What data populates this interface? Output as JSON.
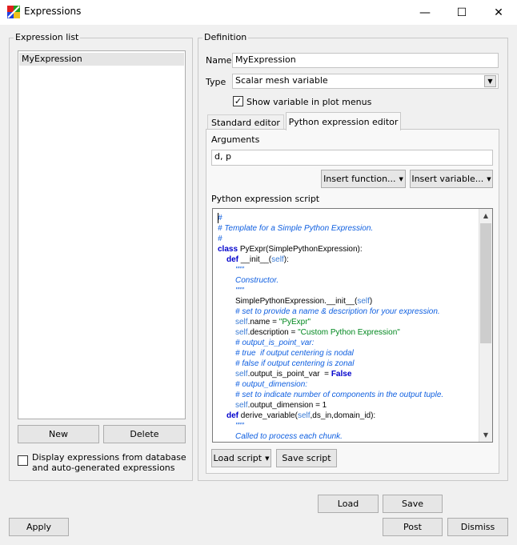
{
  "window": {
    "title": "Expressions",
    "minimize": "—",
    "maximize": "☐",
    "close": "✕"
  },
  "expression_list": {
    "legend": "Expression list",
    "items": [
      "MyExpression"
    ],
    "new_label": "New",
    "delete_label": "Delete",
    "display_checkbox_label_line1": "Display expressions from database",
    "display_checkbox_label_line2": "and auto-generated expressions",
    "display_checked": false
  },
  "definition": {
    "legend": "Definition",
    "name_label": "Name",
    "name_value": "MyExpression",
    "type_label": "Type",
    "type_value": "Scalar mesh variable",
    "show_variable_label": "Show variable in plot menus",
    "show_variable_checked": true,
    "tabs": [
      "Standard editor",
      "Python expression editor"
    ],
    "active_tab": "Python expression editor",
    "arguments_label": "Arguments",
    "arguments_value": "d, p",
    "insert_function_label": "Insert function...",
    "insert_variable_label": "Insert variable...",
    "script_label": "Python expression script",
    "load_script_label": "Load script",
    "save_script_label": "Save script"
  },
  "script_lines": [
    {
      "indent": 0,
      "segments": [
        {
          "t": "#",
          "s": "comment"
        }
      ]
    },
    {
      "indent": 0,
      "segments": [
        {
          "t": "# Template for a Simple Python Expression.",
          "s": "comment"
        }
      ]
    },
    {
      "indent": 0,
      "segments": [
        {
          "t": "#",
          "s": "comment"
        }
      ]
    },
    {
      "indent": 0,
      "segments": [
        {
          "t": "class ",
          "s": "keyword"
        },
        {
          "t": "PyExpr(SimplePythonExpression):",
          "s": "plain"
        }
      ]
    },
    {
      "indent": 1,
      "segments": [
        {
          "t": "def ",
          "s": "keyword"
        },
        {
          "t": "__init__(",
          "s": "plain"
        },
        {
          "t": "self",
          "s": "self"
        },
        {
          "t": "):",
          "s": "plain"
        }
      ]
    },
    {
      "indent": 2,
      "segments": [
        {
          "t": "\"\"\"",
          "s": "comment"
        }
      ]
    },
    {
      "indent": 2,
      "segments": [
        {
          "t": "Constructor.",
          "s": "comment"
        }
      ]
    },
    {
      "indent": 2,
      "segments": [
        {
          "t": "\"\"\"",
          "s": "comment"
        }
      ]
    },
    {
      "indent": 2,
      "segments": [
        {
          "t": "SimplePythonExpression.__init__(",
          "s": "plain"
        },
        {
          "t": "self",
          "s": "self"
        },
        {
          "t": ")",
          "s": "plain"
        }
      ]
    },
    {
      "indent": 2,
      "segments": [
        {
          "t": "# set to provide a name & description for your expression.",
          "s": "comment"
        }
      ]
    },
    {
      "indent": 2,
      "segments": [
        {
          "t": "self",
          "s": "self"
        },
        {
          "t": ".name = ",
          "s": "plain"
        },
        {
          "t": "\"PyExpr\"",
          "s": "string"
        }
      ]
    },
    {
      "indent": 2,
      "segments": [
        {
          "t": "self",
          "s": "self"
        },
        {
          "t": ".description = ",
          "s": "plain"
        },
        {
          "t": "\"Custom Python Expression\"",
          "s": "string"
        }
      ]
    },
    {
      "indent": 2,
      "segments": [
        {
          "t": "# output_is_point_var:",
          "s": "comment"
        }
      ]
    },
    {
      "indent": 2,
      "segments": [
        {
          "t": "# true  if output centering is nodal",
          "s": "comment"
        }
      ]
    },
    {
      "indent": 2,
      "segments": [
        {
          "t": "# false if output centering is zonal",
          "s": "comment"
        }
      ]
    },
    {
      "indent": 2,
      "segments": [
        {
          "t": "self",
          "s": "self"
        },
        {
          "t": ".output_is_point_var  = ",
          "s": "plain"
        },
        {
          "t": "False",
          "s": "keyword"
        }
      ]
    },
    {
      "indent": 2,
      "segments": [
        {
          "t": "# output_dimension:",
          "s": "comment"
        }
      ]
    },
    {
      "indent": 2,
      "segments": [
        {
          "t": "# set to indicate number of components in the output tuple.",
          "s": "comment"
        }
      ]
    },
    {
      "indent": 2,
      "segments": [
        {
          "t": "self",
          "s": "self"
        },
        {
          "t": ".output_dimension = 1",
          "s": "plain"
        }
      ]
    },
    {
      "indent": 1,
      "segments": [
        {
          "t": "def ",
          "s": "keyword"
        },
        {
          "t": "derive_variable(",
          "s": "plain"
        },
        {
          "t": "self",
          "s": "self"
        },
        {
          "t": ",ds_in,domain_id):",
          "s": "plain"
        }
      ]
    },
    {
      "indent": 2,
      "segments": [
        {
          "t": "\"\"\"",
          "s": "comment"
        }
      ]
    },
    {
      "indent": 2,
      "segments": [
        {
          "t": "Called to process each chunk.",
          "s": "comment"
        }
      ]
    }
  ],
  "bottom": {
    "load_label": "Load",
    "save_label": "Save",
    "apply_label": "Apply",
    "post_label": "Post",
    "dismiss_label": "Dismiss"
  }
}
